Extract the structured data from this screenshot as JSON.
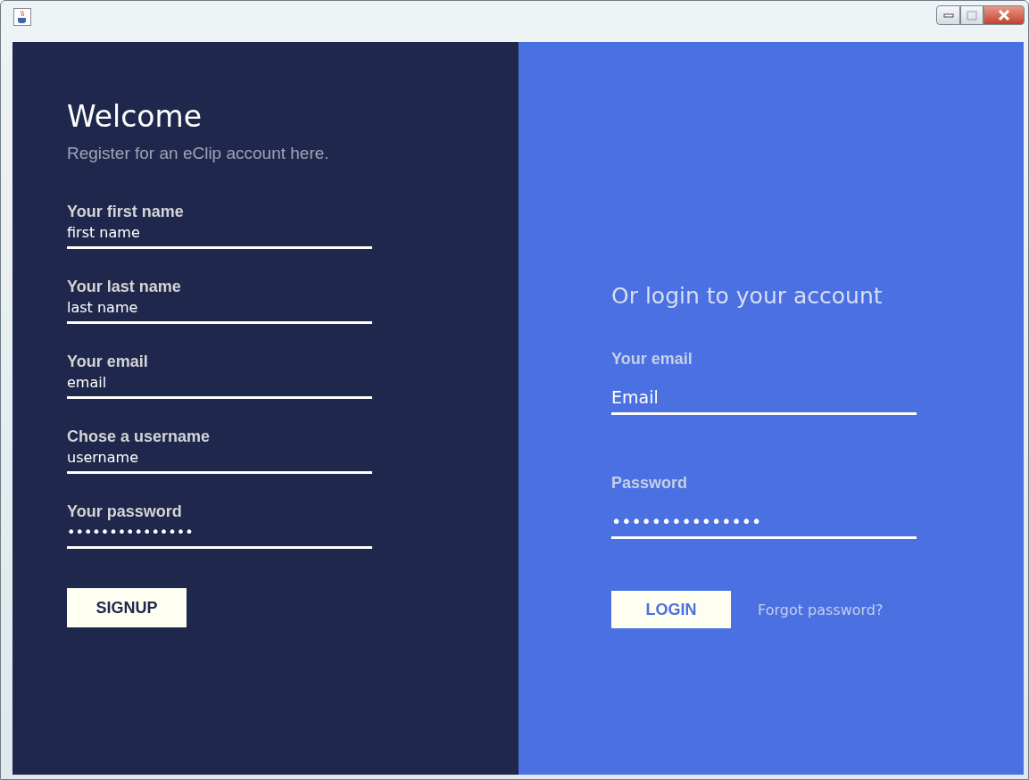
{
  "register": {
    "title": "Welcome",
    "subtitle": "Register for an eClip account here.",
    "fields": [
      {
        "label": "Your first name",
        "value": "first name"
      },
      {
        "label": "Your last name",
        "value": "last name"
      },
      {
        "label": "Your email",
        "value": "email"
      },
      {
        "label": "Chose a username",
        "value": "username"
      },
      {
        "label": "Your password",
        "value": "•••••••••••••••"
      }
    ],
    "button": "SIGNUP"
  },
  "login": {
    "title": "Or login to your account",
    "fields": [
      {
        "label": "Your email",
        "value": "Email"
      },
      {
        "label": "Password",
        "value": "•••••••••••••••"
      }
    ],
    "button": "LOGIN",
    "link": "Forgot password?"
  }
}
